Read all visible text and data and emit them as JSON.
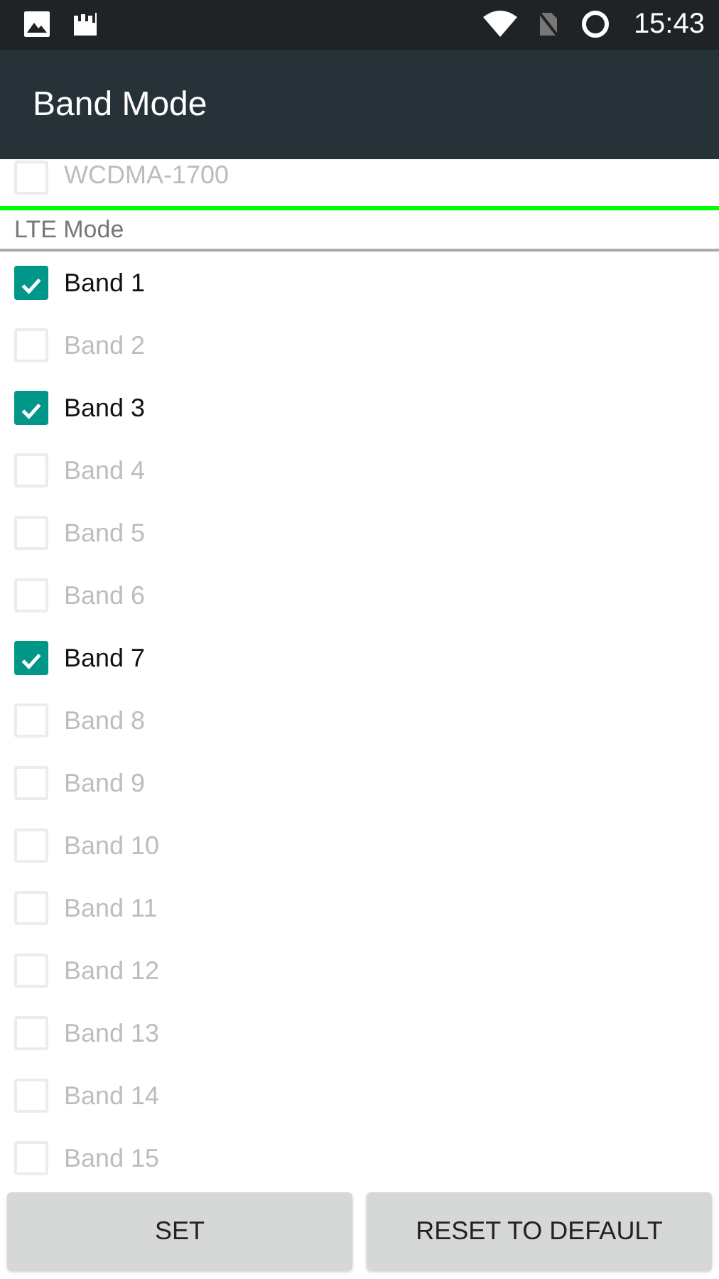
{
  "status_bar": {
    "time": "15:43"
  },
  "app_bar": {
    "title": "Band Mode"
  },
  "previous_item": {
    "label": "WCDMA-1700",
    "checked": false
  },
  "lte_section": {
    "title": "LTE Mode",
    "bands": [
      {
        "label": "Band 1",
        "checked": true
      },
      {
        "label": "Band 2",
        "checked": false
      },
      {
        "label": "Band 3",
        "checked": true
      },
      {
        "label": "Band 4",
        "checked": false
      },
      {
        "label": "Band 5",
        "checked": false
      },
      {
        "label": "Band 6",
        "checked": false
      },
      {
        "label": "Band 7",
        "checked": true
      },
      {
        "label": "Band 8",
        "checked": false
      },
      {
        "label": "Band 9",
        "checked": false
      },
      {
        "label": "Band 10",
        "checked": false
      },
      {
        "label": "Band 11",
        "checked": false
      },
      {
        "label": "Band 12",
        "checked": false
      },
      {
        "label": "Band 13",
        "checked": false
      },
      {
        "label": "Band 14",
        "checked": false
      },
      {
        "label": "Band 15",
        "checked": false
      }
    ]
  },
  "buttons": [
    "SET",
    "RESET TO DEFAULT"
  ]
}
